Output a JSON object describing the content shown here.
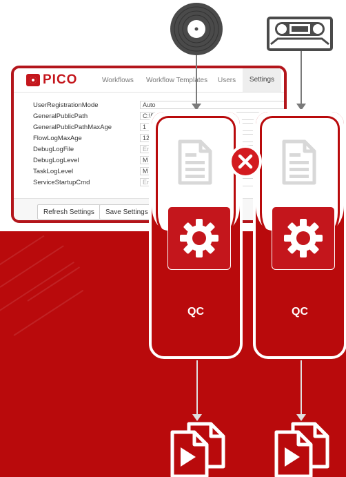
{
  "logo": {
    "text": "PICO"
  },
  "nav": {
    "items": [
      "Workflows",
      "Workflow Templates",
      "Users",
      "Settings"
    ],
    "active": "Settings"
  },
  "settings": [
    {
      "key": "UserRegistrationMode",
      "value": "Auto",
      "is_placeholder": false
    },
    {
      "key": "GeneralPublicPath",
      "value": "C:\\P",
      "is_placeholder": false
    },
    {
      "key": "GeneralPublicPathMaxAge",
      "value": "1",
      "is_placeholder": false
    },
    {
      "key": "FlowLogMaxAge",
      "value": "12",
      "is_placeholder": false
    },
    {
      "key": "DebugLogFile",
      "value": "En",
      "is_placeholder": true
    },
    {
      "key": "DebugLogLevel",
      "value": "M",
      "is_placeholder": false
    },
    {
      "key": "TaskLogLevel",
      "value": "M",
      "is_placeholder": false
    },
    {
      "key": "ServiceStartupCmd",
      "value": "En",
      "is_placeholder": true
    }
  ],
  "buttons": {
    "refresh": "Refresh Settings",
    "save": "Save Settings"
  },
  "cards": [
    {
      "label": "QC",
      "input_icon": "vinyl-record-icon",
      "output_icon": "video-files-icon"
    },
    {
      "label": "QC",
      "input_icon": "vhs-cassette-icon",
      "output_icon": "video-files-icon"
    }
  ],
  "error_badge": {
    "icon": "close-icon"
  },
  "colors": {
    "brand_red": "#c4161c",
    "background_red": "#b90a0c",
    "arrow_gray": "#7a7a7a",
    "icon_dark": "#4a4a4a"
  }
}
